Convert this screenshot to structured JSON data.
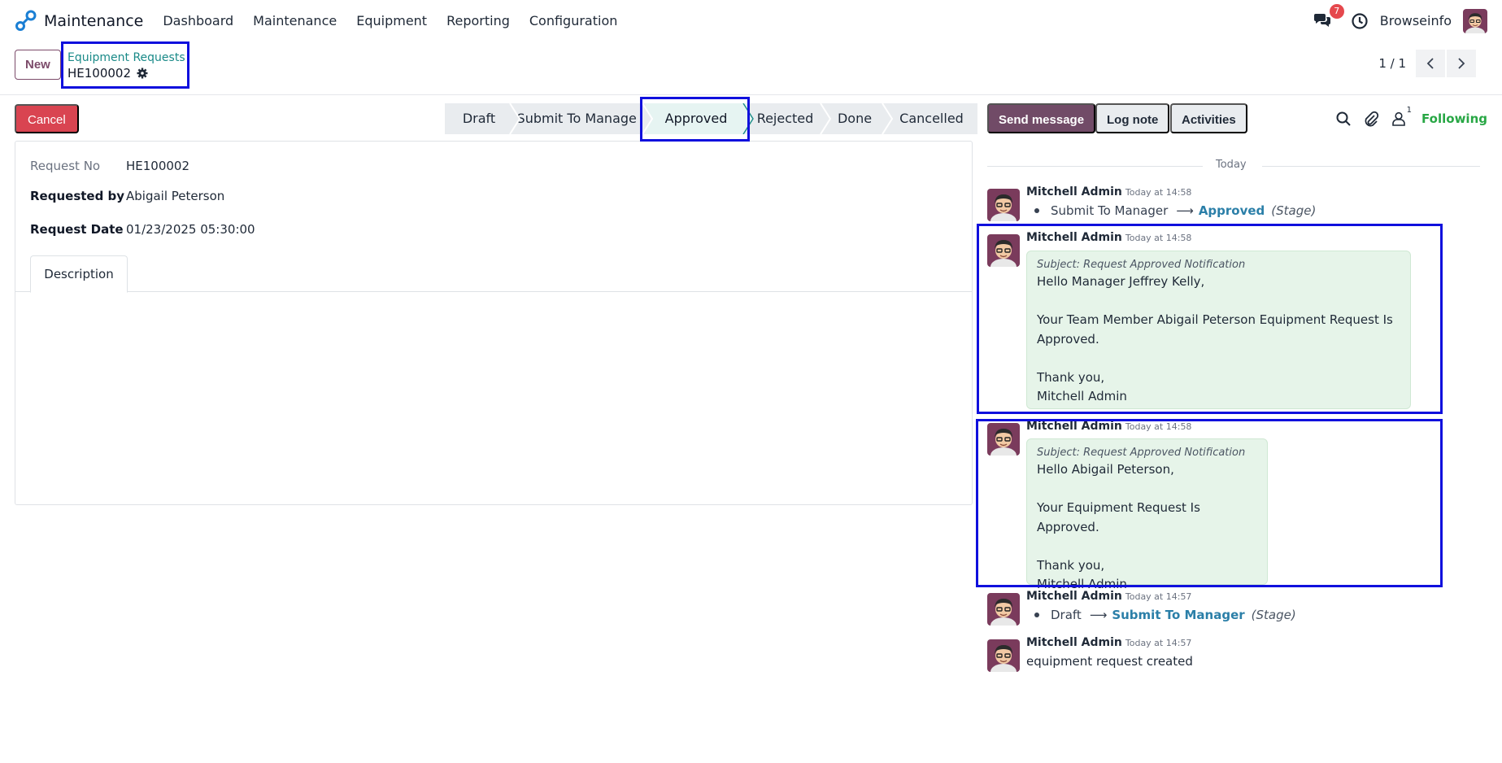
{
  "app": {
    "name": "Maintenance",
    "menu": [
      "Dashboard",
      "Maintenance",
      "Equipment",
      "Reporting",
      "Configuration"
    ],
    "notification_count": "7",
    "company": "Browseinfo"
  },
  "control": {
    "new_label": "New",
    "breadcrumb_parent": "Equipment Requests",
    "breadcrumb_current": "HE100002",
    "pager": "1 / 1"
  },
  "status": {
    "cancel_label": "Cancel",
    "stages": [
      "Draft",
      "Submit To Manager",
      "Approved",
      "Rejected",
      "Done",
      "Cancelled"
    ],
    "active_stage": "Approved"
  },
  "form": {
    "request_no_label": "Request No",
    "request_no": "HE100002",
    "requested_by_label": "Requested by",
    "requested_by": "Abigail Peterson",
    "request_date_label": "Request Date",
    "request_date": "01/23/2025 05:30:00",
    "tab_description": "Description"
  },
  "chatter": {
    "send_message": "Send message",
    "log_note": "Log note",
    "activities": "Activities",
    "follower_count": "1",
    "following": "Following",
    "day": "Today",
    "messages": [
      {
        "author": "Mitchell Admin",
        "time": "Today at 14:58",
        "old": "Submit To Manager",
        "new": "Approved",
        "field": "(Stage)"
      },
      {
        "author": "Mitchell Admin",
        "time": "Today at 14:58",
        "subject": "Subject: Request Approved Notification",
        "line1": "Hello Manager Jeffrey Kelly,",
        "line2": "Your Team Member Abigail Peterson Equipment Request Is Approved.",
        "line3": "Thank you,",
        "line4": "Mitchell Admin"
      },
      {
        "author": "Mitchell Admin",
        "time": "Today at 14:58",
        "subject": "Subject: Request Approved Notification",
        "line1": "Hello Abigail Peterson,",
        "line2": "Your Equipment Request Is Approved.",
        "line3": "Thank you,",
        "line4": "Mitchell Admin"
      },
      {
        "author": "Mitchell Admin",
        "time": "Today at 14:57",
        "old": "Draft",
        "new": "Submit To Manager",
        "field": "(Stage)"
      },
      {
        "author": "Mitchell Admin",
        "time": "Today at 14:57",
        "body": "equipment request created"
      }
    ]
  },
  "colors": {
    "brand": "#714b67",
    "accent_link": "#1a8a88",
    "highlight": "#1010dd",
    "cancel": "#d94451",
    "following": "#28a745"
  }
}
